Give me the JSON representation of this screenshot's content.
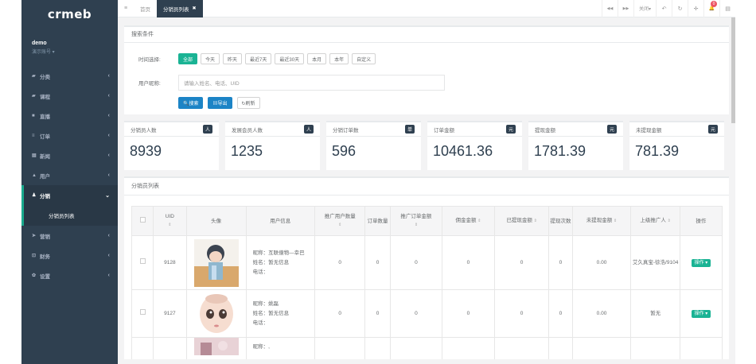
{
  "sidebar": {
    "logo": "crmeb",
    "user_name": "demo",
    "user_role": "演示账号 ▾",
    "items": [
      {
        "label": "分类",
        "icon": "tag-icon",
        "glyph": "▰"
      },
      {
        "label": "课程",
        "icon": "book-icon",
        "glyph": "▰"
      },
      {
        "label": "直播",
        "icon": "video-icon",
        "glyph": "■"
      },
      {
        "label": "订单",
        "icon": "list-icon",
        "glyph": "≡"
      },
      {
        "label": "新闻",
        "icon": "news-icon",
        "glyph": "▤"
      },
      {
        "label": "用户",
        "icon": "user-icon",
        "glyph": "▲"
      }
    ],
    "active_item": {
      "label": "分销",
      "icon": "users-icon",
      "glyph": "♟",
      "chev": "⌄"
    },
    "active_sub": "分销员列表",
    "items_after": [
      {
        "label": "营销",
        "icon": "send-icon",
        "glyph": "➤"
      },
      {
        "label": "财务",
        "icon": "finance-icon",
        "glyph": "⊡"
      },
      {
        "label": "设置",
        "icon": "gear-icon",
        "glyph": "✿"
      }
    ],
    "chev": "‹"
  },
  "topbar": {
    "menu_glyph": "≡",
    "tabs": [
      {
        "label": "首页"
      },
      {
        "label": "分销员列表",
        "close": "✖"
      }
    ],
    "right": {
      "prev": "◀◀",
      "next": "▶▶",
      "close": "关闭▾",
      "back": "↶",
      "refresh": "↻",
      "fullscreen": "✛",
      "notif": "🔔",
      "notif_count": "0",
      "settings": "▤"
    }
  },
  "search": {
    "title": "搜索条件",
    "time_label": "时间选择:",
    "time_options": [
      "全部",
      "今天",
      "昨天",
      "最近7天",
      "最近30天",
      "本月",
      "本年",
      "自定义"
    ],
    "selected": "全部",
    "name_label": "用户昵称:",
    "placeholder": "请输入姓名、电话、UID",
    "btn_search": "🔍搜索",
    "btn_export": "▤导出",
    "btn_refresh": "↻刷新"
  },
  "stats": [
    {
      "label": "分销员人数",
      "badge": "人",
      "value": "8939"
    },
    {
      "label": "发展会员人数",
      "badge": "人",
      "value": "1235"
    },
    {
      "label": "分销订单数",
      "badge": "单",
      "value": "596"
    },
    {
      "label": "订单金额",
      "badge": "元",
      "value": "10461.36"
    },
    {
      "label": "提现金额",
      "badge": "元",
      "value": "1781.39"
    },
    {
      "label": "未提现金额",
      "badge": "元",
      "value": "781.39"
    }
  ],
  "table": {
    "title": "分销员列表",
    "sort_glyph": "⇕",
    "headers": {
      "uid": "UID",
      "avatar": "头像",
      "info": "用户信息",
      "promo_users": "推广用户数量",
      "orders": "订单数量",
      "promo_amount": "推广订单金额",
      "commission": "佣金金额",
      "withdrawn": "已提现金额",
      "withdraw_times": "提现次数",
      "not_withdrawn": "未提现金额",
      "superior": "上级推广人",
      "op": "操作"
    },
    "rows": [
      {
        "uid": "9128",
        "nick": "昵称：互联億物—幸巴",
        "name": "姓名：暂无信息",
        "phone": "电话：",
        "promo_users": "0",
        "orders": "0",
        "promo_amount": "0",
        "commission": "0",
        "withdrawn": "0",
        "withdraw_times": "0",
        "not_withdrawn": "0.00",
        "superior": "艾久真宝-徐浩/9104",
        "op": "操作 ▾"
      },
      {
        "uid": "9127",
        "nick": "昵称：姚磊",
        "name": "姓名：暂无信息",
        "phone": "电话：",
        "promo_users": "0",
        "orders": "0",
        "promo_amount": "0",
        "commission": "0",
        "withdrawn": "0",
        "withdraw_times": "0",
        "not_withdrawn": "0.00",
        "superior": "暂无",
        "op": "操作 ▾"
      },
      {
        "nick": "昵称：,"
      }
    ]
  },
  "colors": {
    "sidebar": "#2f4050",
    "accent": "#1ab394",
    "primary": "#1c84c6"
  }
}
